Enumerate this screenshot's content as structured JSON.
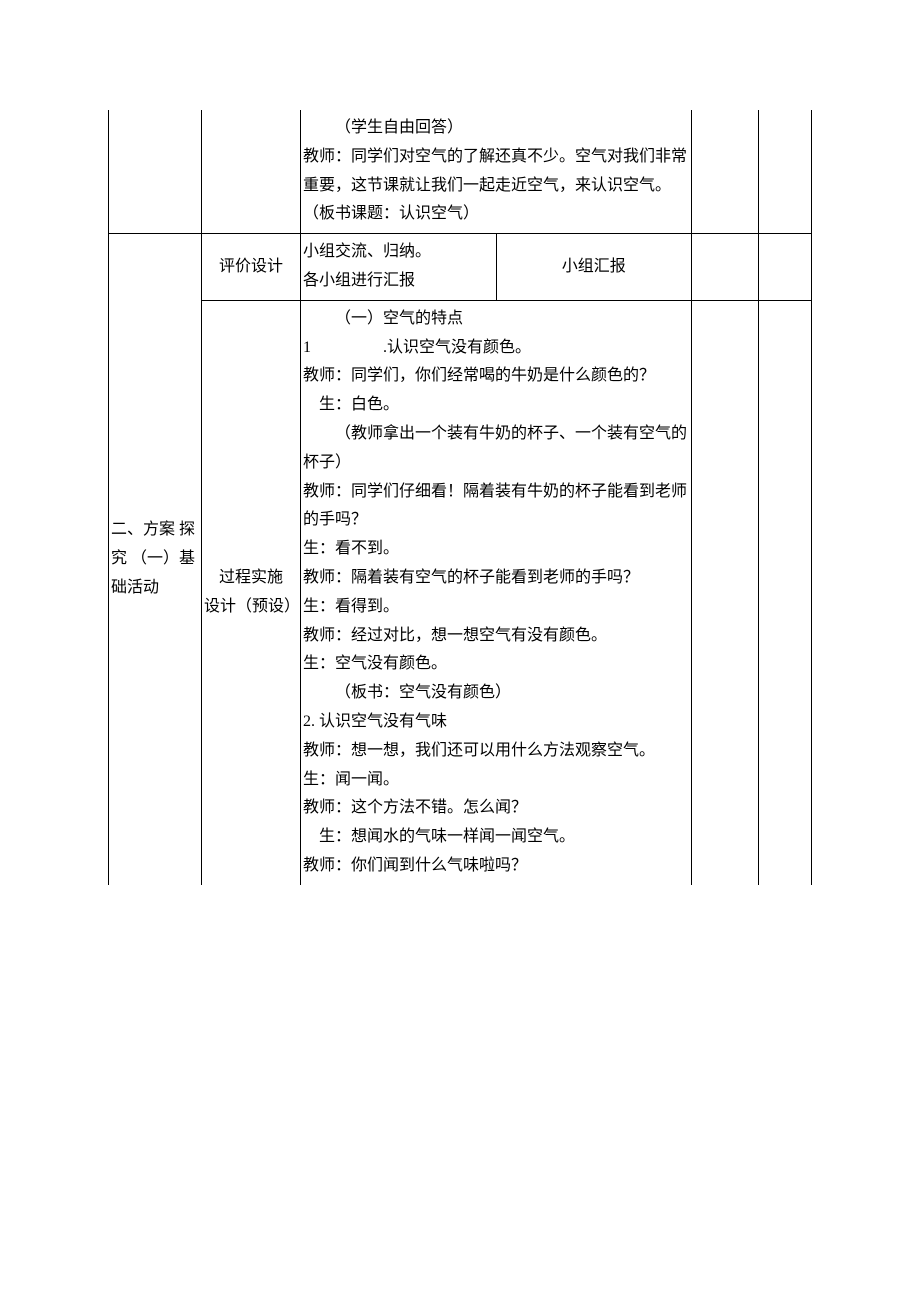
{
  "row1": {
    "content_lines": [
      "（学生自由回答）",
      "教师：同学们对空气的了解还真不少。空气对我们非常重要，这节课就让我们一起走近空气，来认识空气。（板书课题：认识空气）"
    ]
  },
  "row2": {
    "section": "二、方案  探究   （一）基础活动",
    "design": "评价设计",
    "content_col1_lines": [
      "小组交流、归纳。",
      "各小组进行汇报"
    ],
    "content_col2": "小组汇报"
  },
  "row3": {
    "design_line1": "过程实施",
    "design_line2": "设计（预设）",
    "content": {
      "heading": "（一）空气的特点",
      "item1_num": "1",
      "item1_label": ".认识空气没有颜色。",
      "p1": "教师：同学们，你们经常喝的牛奶是什么颜色的？",
      "p2": "生：白色。",
      "p3": "（教师拿出一个装有牛奶的杯子、一个装有空气的杯子）",
      "p4": "教师：同学们仔细看！隔着装有牛奶的杯子能看到老师的手吗？",
      "p5": "生：看不到。",
      "p6": "教师：隔着装有空气的杯子能看到老师的手吗？",
      "p7": "生：看得到。",
      "p8": "教师：经过对比，想一想空气有没有颜色。",
      "p9": "生：空气没有颜色。",
      "p10": "（板书：空气没有颜色）",
      "item2": "2. 认识空气没有气味",
      "p11": "教师：想一想，我们还可以用什么方法观察空气。",
      "p12": "生：闻一闻。",
      "p13": "教师：这个方法不错。怎么闻？",
      "p14": "生：想闻水的气味一样闻一闻空气。",
      "p15": "教师：你们闻到什么气味啦吗？"
    }
  }
}
